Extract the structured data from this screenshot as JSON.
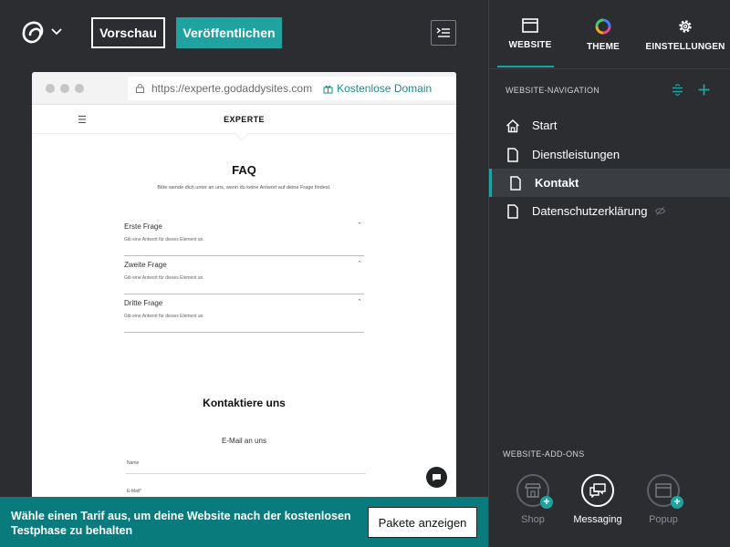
{
  "toolbar": {
    "preview_label": "Vorschau",
    "publish_label": "Veröffentlichen"
  },
  "preview": {
    "url": "https://experte.godaddysites.com",
    "free_domain_label": "Kostenlose Domain",
    "site_title": "EXPERTE",
    "faq": {
      "title": "FAQ",
      "subtitle": "Bitte wende dich unter  an uns, wenn du keine Antwort auf deine Frage findest.",
      "items": [
        {
          "question": "Erste Frage",
          "answer": "Gib eine Antwort für dieses Element an."
        },
        {
          "question": "Zweite Frage",
          "answer": "Gib eine Antwort für dieses Element an."
        },
        {
          "question": "Dritte Frage",
          "answer": "Gib eine Antwort für dieses Element an."
        }
      ]
    },
    "contact": {
      "title": "Kontaktiere uns",
      "subtitle": "E-Mail an uns",
      "field_name": "Name",
      "field_email": "E-Mail*"
    }
  },
  "panel": {
    "tabs": [
      {
        "label": "WEBSITE",
        "icon": "browser-window-icon"
      },
      {
        "label": "THEME",
        "icon": "color-wheel-icon"
      },
      {
        "label": "EINSTELLUNGEN",
        "icon": "gear-icon"
      }
    ],
    "nav_section_label": "WEBSITE-NAVIGATION",
    "nav_items": [
      {
        "label": "Start",
        "icon": "home-icon"
      },
      {
        "label": "Dienstleistungen",
        "icon": "page-icon"
      },
      {
        "label": "Kontakt",
        "icon": "page-icon",
        "active": true
      },
      {
        "label": "Datenschutzerklärung",
        "icon": "page-icon",
        "hidden": true
      }
    ],
    "addons_section_label": "WEBSITE-ADD-ONS",
    "addons": [
      {
        "label": "Shop",
        "icon": "storefront-icon"
      },
      {
        "label": "Messaging",
        "icon": "chat-icon"
      },
      {
        "label": "Popup",
        "icon": "popup-window-icon"
      }
    ]
  },
  "banner": {
    "text": "Wähle einen Tarif aus, um deine Website nach der kostenlosen Testphase zu behalten",
    "button_label": "Pakete anzeigen"
  },
  "colors": {
    "accent": "#1fa2a0",
    "banner": "#097b7d",
    "background": "#2b2d31"
  }
}
